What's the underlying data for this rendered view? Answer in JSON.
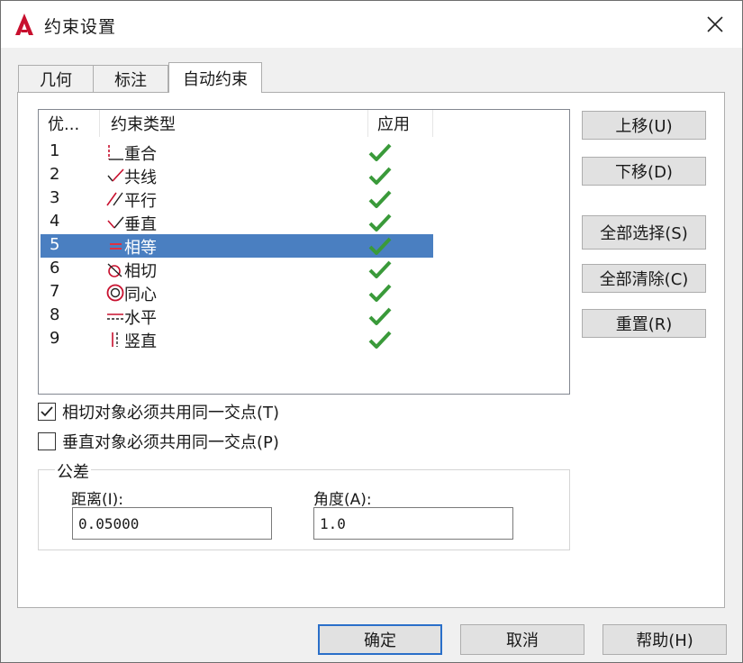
{
  "window": {
    "title": "约束设置",
    "brand_color": "#c8102e"
  },
  "tabs": [
    {
      "label": "几何",
      "active": false
    },
    {
      "label": "标注",
      "active": false
    },
    {
      "label": "自动约束",
      "active": true
    }
  ],
  "list": {
    "columns": [
      "优...",
      "约束类型",
      "应用"
    ],
    "rows": [
      {
        "priority": "1",
        "icon": "coincident-icon",
        "name": "重合",
        "applied": true
      },
      {
        "priority": "2",
        "icon": "collinear-icon",
        "name": "共线",
        "applied": true
      },
      {
        "priority": "3",
        "icon": "parallel-icon",
        "name": "平行",
        "applied": true
      },
      {
        "priority": "4",
        "icon": "perpendicular-icon",
        "name": "垂直",
        "applied": true
      },
      {
        "priority": "5",
        "icon": "equal-icon",
        "name": "相等",
        "applied": true,
        "selected": true
      },
      {
        "priority": "6",
        "icon": "tangent-icon",
        "name": "相切",
        "applied": true
      },
      {
        "priority": "7",
        "icon": "concentric-icon",
        "name": "同心",
        "applied": true
      },
      {
        "priority": "8",
        "icon": "horizontal-icon",
        "name": "水平",
        "applied": true
      },
      {
        "priority": "9",
        "icon": "vertical-icon",
        "name": "竖直",
        "applied": true
      }
    ],
    "check_color": "#3a9a3a",
    "selection_color": "#4a7fc1"
  },
  "side_buttons": {
    "move_up": "上移(U)",
    "move_down": "下移(D)",
    "select_all": "全部选择(S)",
    "clear_all": "全部清除(C)",
    "reset": "重置(R)"
  },
  "options": {
    "tangent_shared": {
      "label": "相切对象必须共用同一交点(T)",
      "checked": true
    },
    "perpendicular_shared": {
      "label": "垂直对象必须共用同一交点(P)",
      "checked": false
    }
  },
  "tolerance": {
    "title": "公差",
    "distance_label": "距离(I):",
    "distance_value": "0.05000",
    "angle_label": "角度(A):",
    "angle_value": "1.0"
  },
  "footer": {
    "ok": "确定",
    "cancel": "取消",
    "help": "帮助(H)"
  }
}
